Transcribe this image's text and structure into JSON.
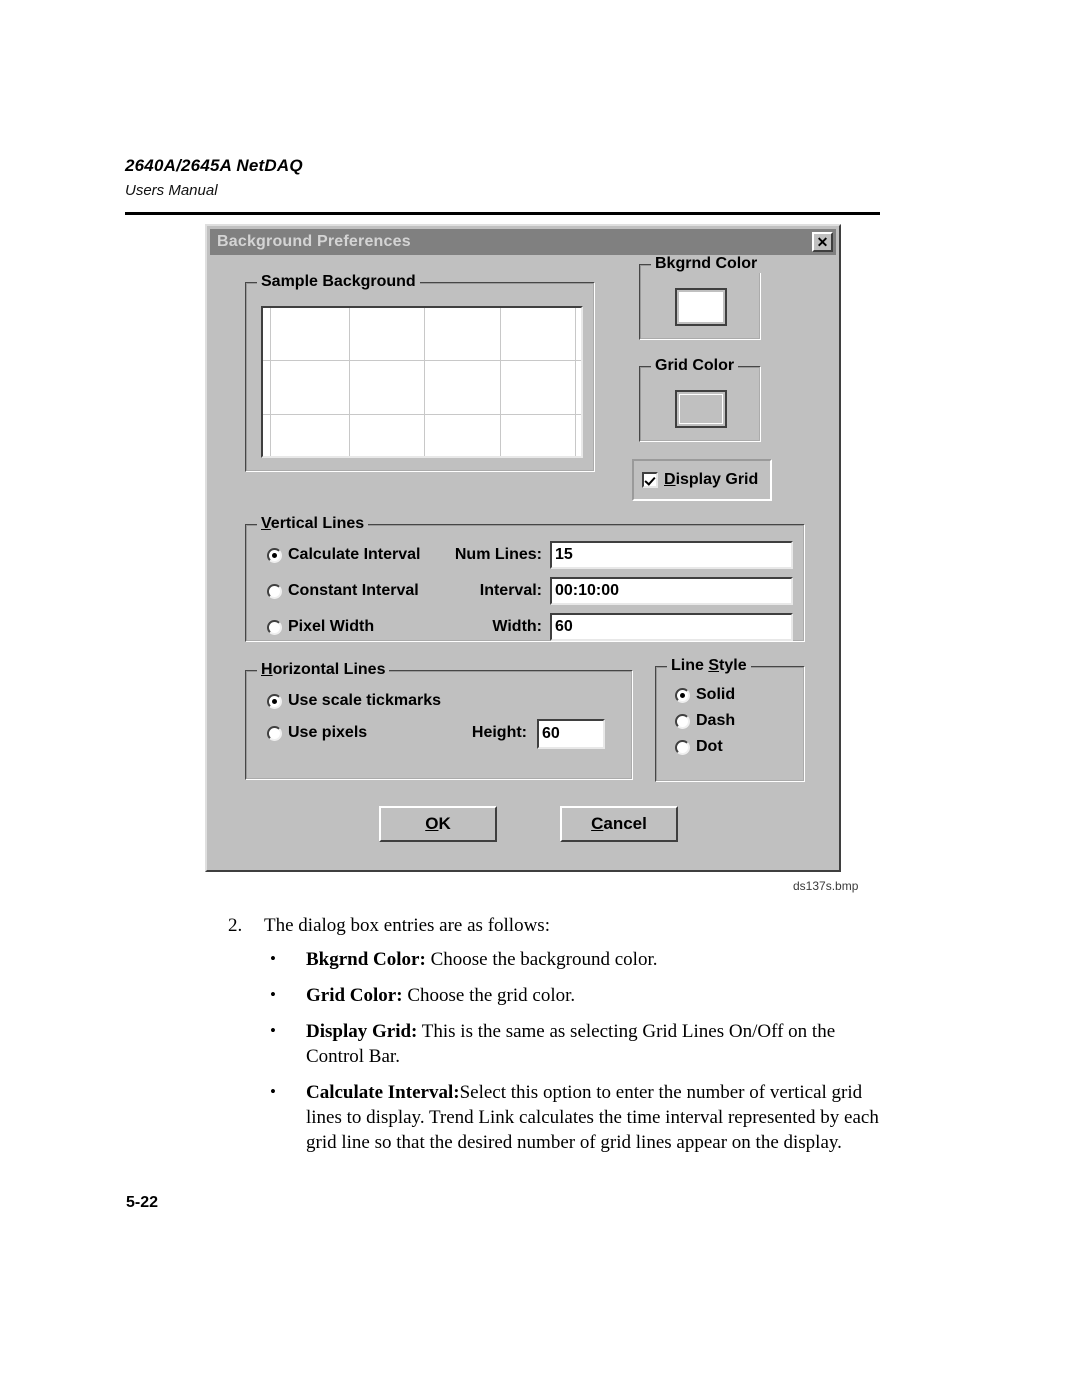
{
  "header": {
    "title": "2640A/2645A NetDAQ",
    "subtitle": "Users Manual"
  },
  "dialog": {
    "title": "Background Preferences",
    "close_icon": "close-icon",
    "close_glyph": "✕",
    "sample_background": {
      "legend": "Sample Background",
      "vertical_line_count": 5,
      "horizontal_line_count": 2,
      "background_color": "#ffffff",
      "grid_line_color": "#c8c8c8"
    },
    "bkgrnd_color": {
      "legend": "Bkgrnd Color",
      "swatch_color": "#ffffff"
    },
    "grid_color": {
      "legend": "Grid Color",
      "swatch_color": "#c0c0c0"
    },
    "display_grid": {
      "label_prefix": "",
      "label_accel": "D",
      "label_rest": "isplay Grid",
      "checked": true
    },
    "vertical_lines": {
      "legend_accel": "V",
      "legend_rest": "ertical Lines",
      "options": [
        {
          "label": "Calculate Interval",
          "selected": true
        },
        {
          "label": "Constant Interval",
          "selected": false
        },
        {
          "label": "Pixel Width",
          "selected": false
        }
      ],
      "fields": [
        {
          "label": "Num Lines:",
          "value": "15"
        },
        {
          "label": "Interval:",
          "value": "00:10:00"
        },
        {
          "label": "Width:",
          "value": "60"
        }
      ]
    },
    "horizontal_lines": {
      "legend_accel": "H",
      "legend_rest": "orizontal Lines",
      "options": [
        {
          "label": "Use scale tickmarks",
          "selected": true
        },
        {
          "label": "Use pixels",
          "selected": false
        }
      ],
      "height_field": {
        "label": "Height:",
        "value": "60"
      }
    },
    "line_style": {
      "legend_prefix": "Line ",
      "legend_accel": "S",
      "legend_rest": "tyle",
      "options": [
        {
          "label": "Solid",
          "selected": true
        },
        {
          "label": "Dash",
          "selected": false
        },
        {
          "label": "Dot",
          "selected": false
        }
      ]
    },
    "buttons": {
      "ok_accel": "O",
      "ok_rest": "K",
      "cancel_accel": "C",
      "cancel_rest": "ancel"
    }
  },
  "figure_caption": "ds137s.bmp",
  "body": {
    "step_number": "2.",
    "step_text": "The dialog box entries are as follows:",
    "bullets": [
      {
        "term": "Bkgrnd Color:",
        "text": " Choose the background color."
      },
      {
        "term": "Grid Color:",
        "text": " Choose the grid color."
      },
      {
        "term": "Display Grid:",
        "text": " This is the same as selecting Grid Lines On/Off on the Control Bar."
      },
      {
        "term": "Calculate Interval:",
        "text": "Select this option to enter the number of vertical grid lines to display. Trend Link calculates the time interval represented by each grid line so that the desired number of grid lines appear on the display."
      }
    ]
  },
  "page_number": "5-22"
}
